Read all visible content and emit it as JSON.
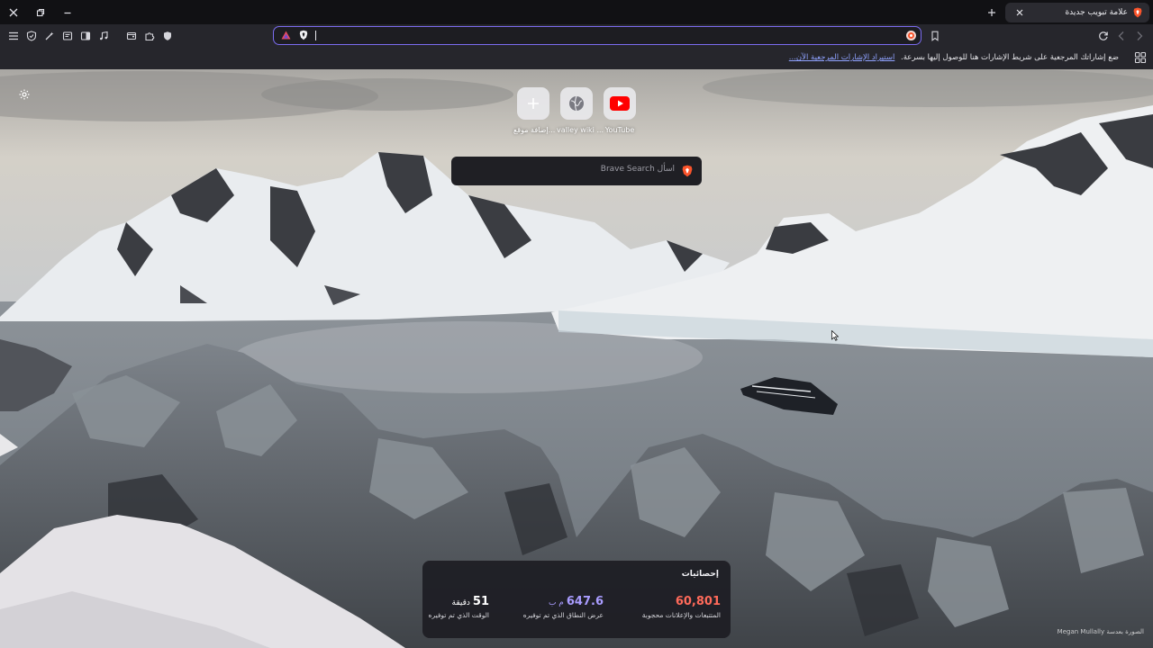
{
  "tab": {
    "title": "علامة تبويب جديدة"
  },
  "bookmarks_bar": {
    "prompt_text": "ضع إشاراتك المرجعية على شريط الإشارات هنا للوصول إليها بسرعة.",
    "import_link": "استيراد الإشارات المرجعية الآن..."
  },
  "top_sites": [
    {
      "label": "YouTube",
      "icon": "youtube-icon"
    },
    {
      "label": "valley wiki ...",
      "icon": "globe-icon"
    },
    {
      "label": "إضافة موقع...",
      "icon": "plus-icon"
    }
  ],
  "search": {
    "placeholder": "اسأل Brave Search"
  },
  "stats": {
    "heading": "إحصائيات",
    "trackers": {
      "value": "60,801",
      "caption": "المتتبعات والإعلانات محجوبة",
      "color": "#ff6a5a"
    },
    "bandwidth": {
      "value": "647.6",
      "unit": "م ب",
      "caption": "عرض النطاق الذي تم توفيره",
      "color": "#a99cff"
    },
    "time": {
      "value": "51",
      "unit": "دقيقة",
      "caption": "الوقت الذي تم توفيره",
      "color": "#ffffff"
    }
  },
  "photo_credit": "الصورة بعدسة Megan Mullally",
  "colors": {
    "accent": "#7b6cf0",
    "brave_orange": "#fb542b",
    "youtube_red": "#ff0000"
  }
}
